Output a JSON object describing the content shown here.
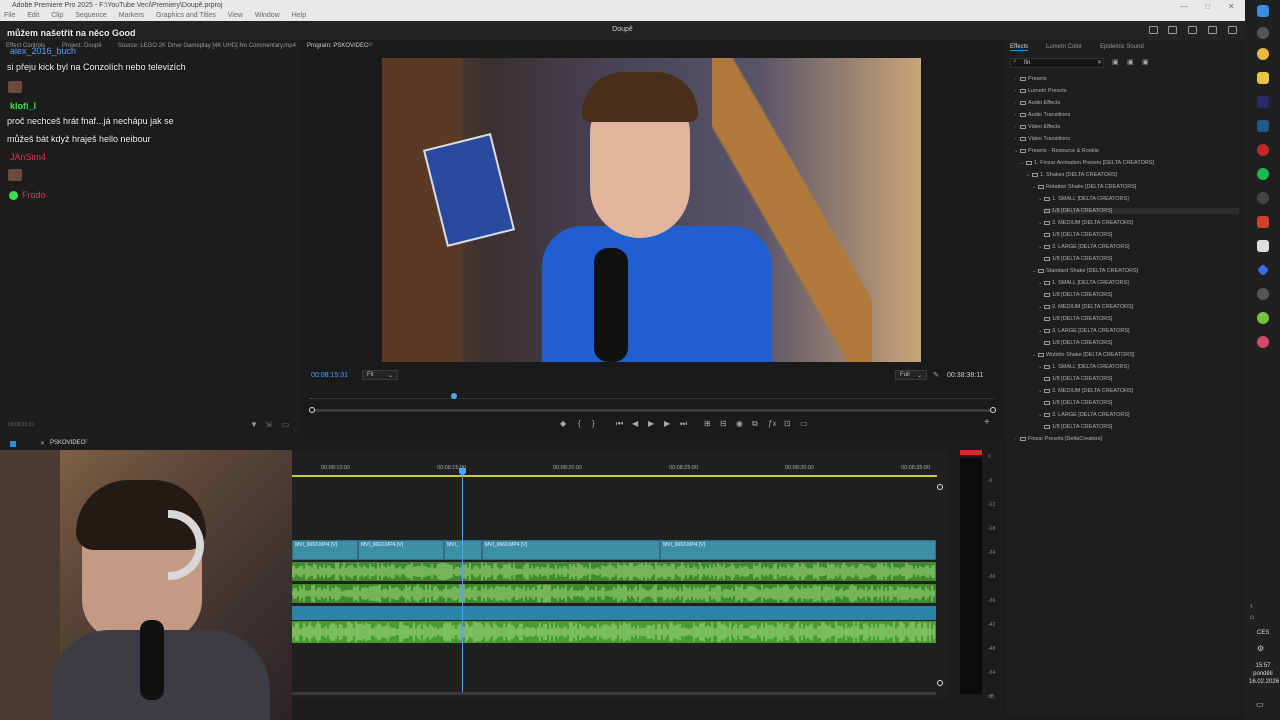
{
  "window": {
    "title": "Adobe Premiere Pro 2025 - F:\\YouTube Veci\\Premiery\\Doupě.prproj",
    "menu": [
      "File",
      "Edit",
      "Clip",
      "Sequence",
      "Markers",
      "Graphics and Titles",
      "View",
      "Window",
      "Help"
    ]
  },
  "header": {
    "project_name": "Doupě"
  },
  "source_panel": {
    "tabs": [
      "Effect Controls",
      "Project: Doupě",
      "Source: LEGO 2K Drive Gameplay [4K UHD] No Commentary.mp4"
    ],
    "timecode": "00:08:15:31"
  },
  "chat": {
    "messages": [
      {
        "text": "můžem našetřit na něco Good"
      },
      {
        "user": "alex_2016_buch",
        "user_color": "#5aa0ff"
      },
      {
        "text": "si přeju kick byl na Conzolích nebo televizích"
      },
      {
        "user": "klofi_l",
        "user_color": "#3ee04a"
      },
      {
        "text": "proč nechceš hrát fnaf...já nechápu jak se"
      },
      {
        "text": "můžeš bát když hraješ hello neibour"
      },
      {
        "user": "JAnSim4",
        "user_color": "#e0305a"
      },
      {
        "user": "Frodo",
        "user_color": "#3ee04a"
      }
    ]
  },
  "program_panel": {
    "title": "Program: PSKOVIDEO",
    "current_time": "00:08:15:31",
    "fit_option": "Fit",
    "quality_option": "Full",
    "duration": "00:38:38:11"
  },
  "effects_panel": {
    "tabs": [
      "Effects",
      "Lumetri Color",
      "Epidemic Sound"
    ],
    "search_value": "fin",
    "tree": [
      {
        "label": "Presets",
        "depth": 0,
        "type": "arrow"
      },
      {
        "label": "Lumetri Presets",
        "depth": 0,
        "type": "arrow"
      },
      {
        "label": "Audio Effects",
        "depth": 0,
        "type": "arrow"
      },
      {
        "label": "Audio Transitions",
        "depth": 0,
        "type": "arrow"
      },
      {
        "label": "Video Effects",
        "depth": 0,
        "type": "arrow"
      },
      {
        "label": "Video Transitions",
        "depth": 0,
        "type": "arrow"
      },
      {
        "label": "Presets - Resource & Rookie",
        "depth": 0,
        "type": "open"
      },
      {
        "label": "1. Finzar Animation Presets [DELTA CREATORS]",
        "depth": 1,
        "type": "open"
      },
      {
        "label": "1. Shakes [DELTA CREATORS]",
        "depth": 2,
        "type": "open"
      },
      {
        "label": "Rotation Shake [DELTA CREATORS]",
        "depth": 3,
        "type": "open"
      },
      {
        "label": "1. SMALL [DELTA CREATORS]",
        "depth": 4,
        "type": "open"
      },
      {
        "label": "1/8 [DELTA CREATORS]",
        "depth": 5,
        "type": "item",
        "selected": true
      },
      {
        "label": "2. MEDIUM [DELTA CREATORS]",
        "depth": 4,
        "type": "open"
      },
      {
        "label": "1/8 [DELTA CREATORS]",
        "depth": 5,
        "type": "item"
      },
      {
        "label": "3. LARGE [DELTA CREATORS]",
        "depth": 4,
        "type": "open"
      },
      {
        "label": "1/8 [DELTA CREATORS]",
        "depth": 5,
        "type": "item"
      },
      {
        "label": "Standard Shake [DELTA CREATORS]",
        "depth": 3,
        "type": "open"
      },
      {
        "label": "1. SMALL [DELTA CREATORS]",
        "depth": 4,
        "type": "open"
      },
      {
        "label": "1/8 [DELTA CREATORS]",
        "depth": 5,
        "type": "item"
      },
      {
        "label": "2. MEDIUM [DELTA CREATORS]",
        "depth": 4,
        "type": "open"
      },
      {
        "label": "1/8 [DELTA CREATORS]",
        "depth": 5,
        "type": "item"
      },
      {
        "label": "3. LARGE [DELTA CREATORS]",
        "depth": 4,
        "type": "open"
      },
      {
        "label": "1/8 [DELTA CREATORS]",
        "depth": 5,
        "type": "item"
      },
      {
        "label": "Wobble Shake [DELTA CREATORS]",
        "depth": 3,
        "type": "open"
      },
      {
        "label": "1. SMALL [DELTA CREATORS]",
        "depth": 4,
        "type": "open"
      },
      {
        "label": "1/8 [DELTA CREATORS]",
        "depth": 5,
        "type": "item"
      },
      {
        "label": "2. MEDIUM [DELTA CREATORS]",
        "depth": 4,
        "type": "open"
      },
      {
        "label": "1/8 [DELTA CREATORS]",
        "depth": 5,
        "type": "item"
      },
      {
        "label": "3. LARGE [DELTA CREATORS]",
        "depth": 4,
        "type": "open"
      },
      {
        "label": "1/8 [DELTA CREATORS]",
        "depth": 5,
        "type": "item"
      },
      {
        "label": "Finzar Presets [DeltaCreators]",
        "depth": 0,
        "type": "arrow"
      }
    ]
  },
  "timeline": {
    "sequence_name": "PSKOVIDEO",
    "timecodes": [
      "00:08:10:00",
      "00:08:15:00",
      "00:08:20:00",
      "00:08:25:00",
      "00:08:30:00",
      "00:08:35:00"
    ],
    "video_clips": [
      {
        "label": "MVI_9663.MP4 [V]"
      },
      {
        "label": "MVI_9663.MP4 [V]"
      },
      {
        "label": "MVI_"
      },
      {
        "label": "MVI_9663.MP4 [V]"
      },
      {
        "label": "MVI_9663.MP4 [V]"
      }
    ],
    "meter_scale": [
      "0",
      "-6",
      "-12",
      "-18",
      "-24",
      "-30",
      "-36",
      "-42",
      "-48",
      "-54",
      "dB"
    ]
  },
  "taskbar": {
    "language": "CES",
    "time": "15:57",
    "day": "pondělí",
    "date": "16.02.2026"
  },
  "colors": {
    "accent_blue": "#2f8fd8",
    "video_clip": "#3d8fa8",
    "audio_clip": "#3f8a2c",
    "audio_wave": "#a9e08a",
    "playhead": "#4aa7ff"
  }
}
